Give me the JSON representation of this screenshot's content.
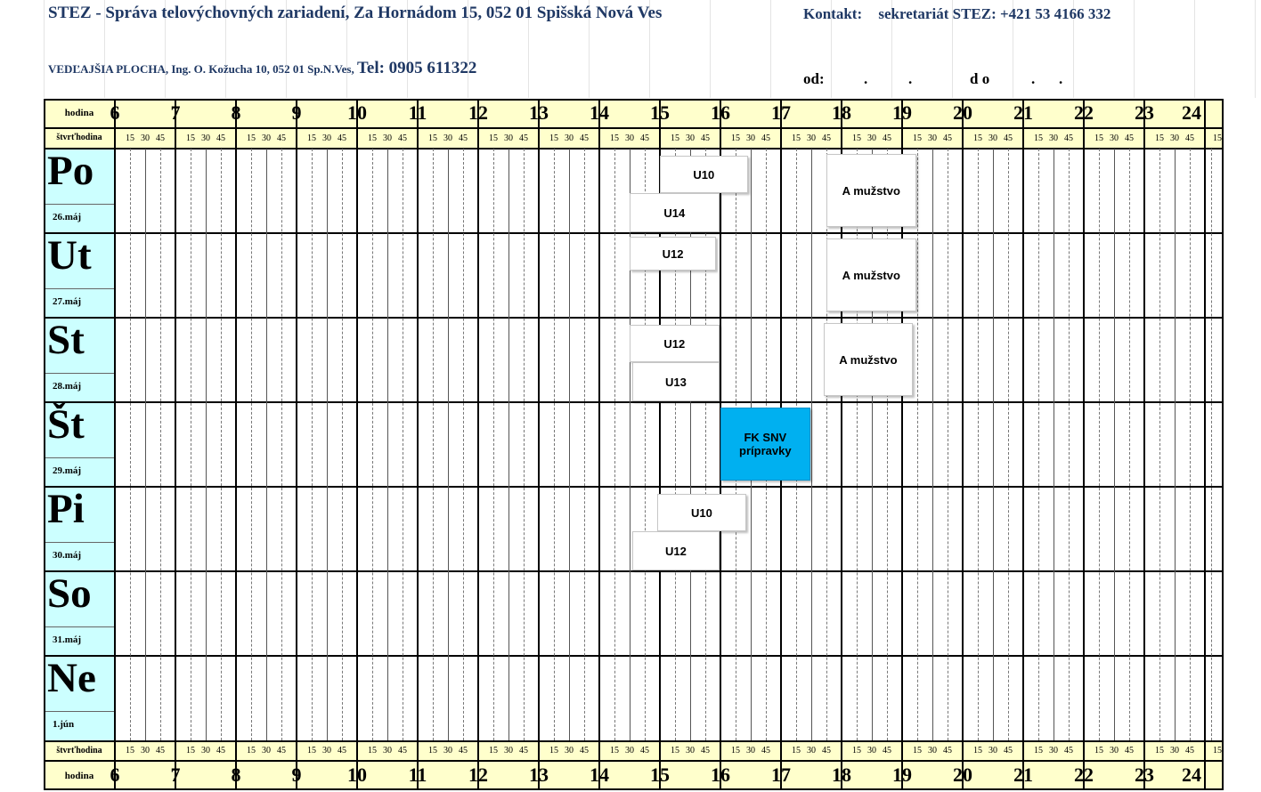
{
  "header": {
    "title": "STEZ - Správa telovýchovných zariadení, Za Hornádom 15, 052 01 Spišská Nová Ves",
    "contact_label": "Kontakt:",
    "contact_value": "sekretariát STEZ: +421 53 4166 332",
    "sub_address": "VEDĽAJŠIA PLOCHA, Ing. O. Kožucha 10, 052 01 Sp.N.Ves,",
    "sub_tel": "Tel: 0905 611322",
    "od_label": "od:",
    "do_label": "d o"
  },
  "grid": {
    "hour_label": "hodina",
    "quarter_label": "štvrťhodina",
    "hours": [
      "6",
      "7",
      "8",
      "9",
      "10",
      "11",
      "12",
      "13",
      "14",
      "15",
      "16",
      "17",
      "18",
      "19",
      "20",
      "21",
      "22",
      "23",
      "24"
    ],
    "quarters": [
      "15",
      "30",
      "45"
    ]
  },
  "days": [
    {
      "name": "Po",
      "date": "26.máj"
    },
    {
      "name": "Ut",
      "date": "27.máj"
    },
    {
      "name": "St",
      "date": "28.máj"
    },
    {
      "name": "Št",
      "date": "29.máj"
    },
    {
      "name": "Pi",
      "date": "30.máj"
    },
    {
      "name": "So",
      "date": "31.máj"
    },
    {
      "name": "Ne",
      "date": "1.jún"
    }
  ],
  "events": [
    {
      "day": 0,
      "start": 15.0,
      "end": 16.42,
      "slot": "top",
      "label": "U10"
    },
    {
      "day": 0,
      "start": 14.5,
      "end": 15.95,
      "slot": "bottom",
      "label": "U14"
    },
    {
      "day": 0,
      "start": 17.75,
      "end": 19.2,
      "slot": "full",
      "label": "A mužstvo"
    },
    {
      "day": 1,
      "start": 14.5,
      "end": 15.9,
      "slot": "upper",
      "label": "U12"
    },
    {
      "day": 1,
      "start": 17.75,
      "end": 19.2,
      "slot": "full",
      "label": "A mužstvo"
    },
    {
      "day": 2,
      "start": 14.5,
      "end": 15.95,
      "slot": "top",
      "label": "U12"
    },
    {
      "day": 2,
      "start": 14.55,
      "end": 15.95,
      "slot": "bottom",
      "label": "U13"
    },
    {
      "day": 2,
      "start": 17.7,
      "end": 19.15,
      "slot": "full",
      "label": "A mužstvo"
    },
    {
      "day": 3,
      "start": 16.0,
      "end": 17.45,
      "slot": "full",
      "label": "FK SNV prípravky",
      "color": "#00b0f0"
    },
    {
      "day": 4,
      "start": 14.95,
      "end": 16.4,
      "slot": "top",
      "label": "U10"
    },
    {
      "day": 4,
      "start": 14.55,
      "end": 15.95,
      "slot": "bottom",
      "label": "U12"
    }
  ]
}
